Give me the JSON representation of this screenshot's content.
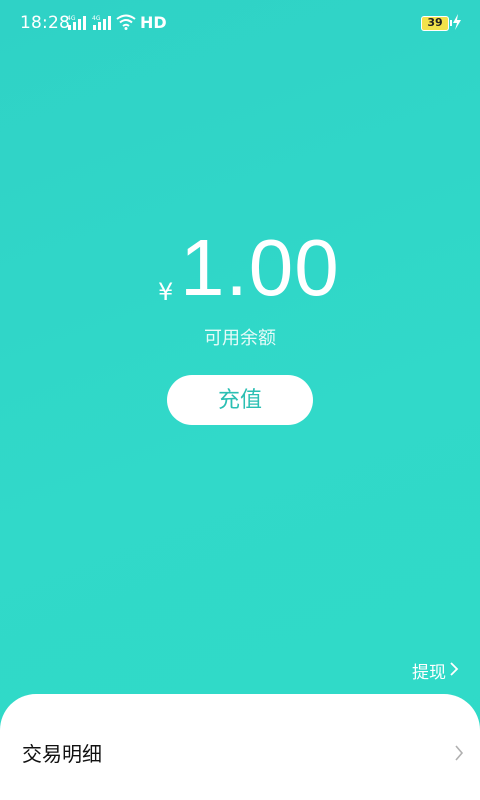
{
  "status_bar": {
    "time": "18:28",
    "network_type_1": "4G",
    "network_type_2": "4G",
    "hd_label": "HD",
    "battery_level": "39",
    "icons": [
      "signal-icon",
      "signal-icon",
      "wifi-icon",
      "battery-icon",
      "charging-icon"
    ]
  },
  "balance": {
    "currency_symbol": "¥",
    "amount": "1.00",
    "label": "可用余额"
  },
  "actions": {
    "recharge_label": "充值",
    "withdraw_label": "提现"
  },
  "transactions": {
    "title": "交易明细"
  },
  "colors": {
    "background": "#31d9c9",
    "button_text": "#2bbfb3",
    "card": "#ffffff"
  }
}
